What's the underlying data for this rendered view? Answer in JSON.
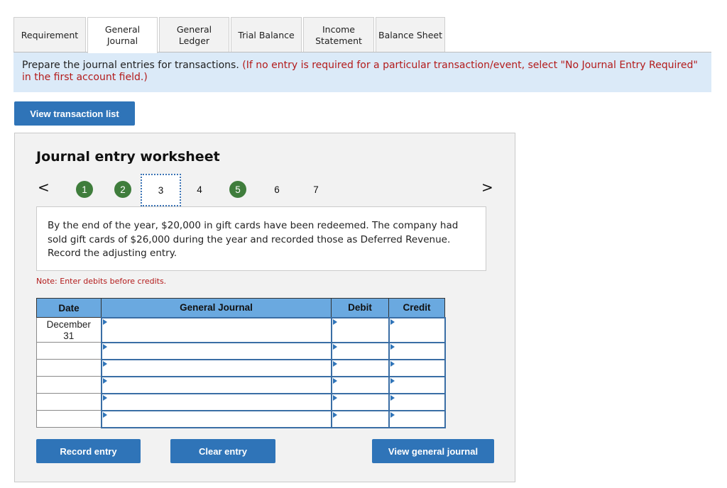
{
  "tabs": [
    {
      "label_line1": "Requirement",
      "label_line2": "",
      "active": false
    },
    {
      "label_line1": "General",
      "label_line2": "Journal",
      "active": true
    },
    {
      "label_line1": "General",
      "label_line2": "Ledger",
      "active": false
    },
    {
      "label_line1": "Trial Balance",
      "label_line2": "",
      "active": false
    },
    {
      "label_line1": "Income",
      "label_line2": "Statement",
      "active": false
    },
    {
      "label_line1": "Balance Sheet",
      "label_line2": "",
      "active": false
    }
  ],
  "banner": {
    "text": "Prepare the journal entries for transactions.",
    "note": "(If no entry is required for a particular transaction/event, select \"No Journal Entry Required\" in the first account field.)"
  },
  "view_transaction_list_label": "View transaction list",
  "worksheet": {
    "title": "Journal entry worksheet",
    "prev_icon": "chevron-left-icon",
    "next_icon": "chevron-right-icon",
    "prev_glyph": "<",
    "next_glyph": ">",
    "steps": [
      {
        "label": "1",
        "status": "completed"
      },
      {
        "label": "2",
        "status": "completed"
      },
      {
        "label": "3",
        "status": "current"
      },
      {
        "label": "4",
        "status": "pending"
      },
      {
        "label": "5",
        "status": "completed"
      },
      {
        "label": "6",
        "status": "pending"
      },
      {
        "label": "7",
        "status": "pending"
      }
    ],
    "scenario": "By the end of the year, $20,000 in gift cards have been redeemed. The company had sold gift cards of $26,000 during the year and recorded those as Deferred Revenue. Record the adjusting entry.",
    "note": "Note: Enter debits before credits.",
    "table": {
      "headers": {
        "date": "Date",
        "account": "General Journal",
        "debit": "Debit",
        "credit": "Credit"
      },
      "rows": [
        {
          "date_line1": "December",
          "date_line2": "31",
          "account": "",
          "debit": "",
          "credit": ""
        },
        {
          "date_line1": "",
          "date_line2": "",
          "account": "",
          "debit": "",
          "credit": ""
        },
        {
          "date_line1": "",
          "date_line2": "",
          "account": "",
          "debit": "",
          "credit": ""
        },
        {
          "date_line1": "",
          "date_line2": "",
          "account": "",
          "debit": "",
          "credit": ""
        },
        {
          "date_line1": "",
          "date_line2": "",
          "account": "",
          "debit": "",
          "credit": ""
        },
        {
          "date_line1": "",
          "date_line2": "",
          "account": "",
          "debit": "",
          "credit": ""
        }
      ]
    },
    "buttons": {
      "record": "Record entry",
      "clear": "Clear entry",
      "view_journal": "View general journal"
    }
  },
  "colors": {
    "primary_button": "#2f74b8",
    "completed_step": "#3f7d3c",
    "banner_bg": "#dbeaf8",
    "table_header": "#6aa9e0",
    "warning_text": "#b31b1b"
  }
}
